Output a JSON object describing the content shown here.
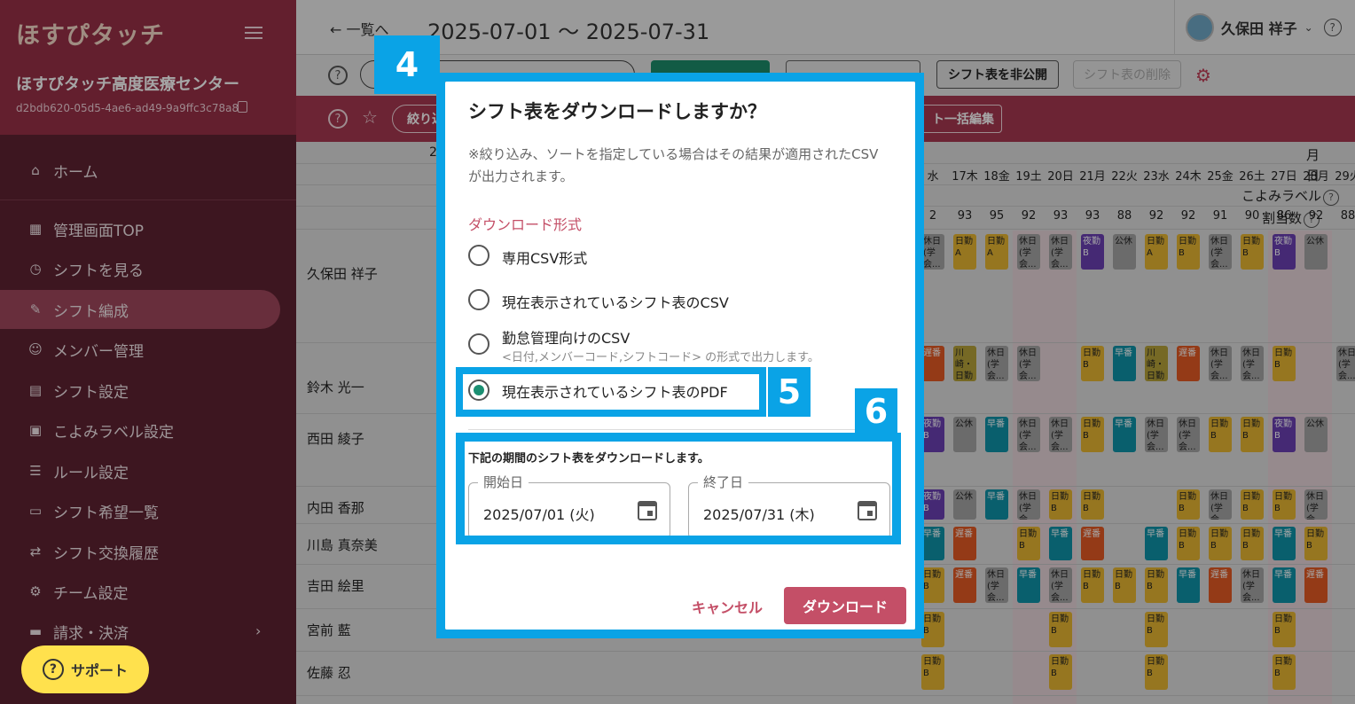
{
  "sidebar": {
    "logo": "ほすぴタッチ",
    "org_name": "ほすぴタッチ高度医療センター",
    "org_id": "d2bdb620-05d5-4ae6-ad49-9a9ffc3c78a8",
    "items": [
      {
        "label": "ホーム",
        "icon": "⌂"
      },
      {
        "label": "管理画面TOP",
        "icon": "▦"
      },
      {
        "label": "シフトを見る",
        "icon": "◷"
      },
      {
        "label": "シフト編成",
        "icon": "✎"
      },
      {
        "label": "メンバー管理",
        "icon": "☺"
      },
      {
        "label": "シフト設定",
        "icon": "▤"
      },
      {
        "label": "こよみラベル設定",
        "icon": "▣"
      },
      {
        "label": "ルール設定",
        "icon": "☰"
      },
      {
        "label": "シフト希望一覧",
        "icon": "▭"
      },
      {
        "label": "シフト交換履歴",
        "icon": "⇄"
      },
      {
        "label": "チーム設定",
        "icon": "⚙"
      },
      {
        "label": "請求・決済",
        "icon": "▬"
      }
    ],
    "chevron": "›",
    "support_label": "サポート",
    "support_icon": "?"
  },
  "topbar": {
    "back_label": "← 一覧へ",
    "date_range": "2025-07-01 〜 2025-07-31",
    "user_name": "久保田 祥子",
    "chevron": "⌄",
    "help": "?"
  },
  "toolbar": {
    "help": "?",
    "unpublish_label": "シフト表を非公開",
    "delete_label": "シフト表の削除",
    "gear": "⚙"
  },
  "filterbar": {
    "help": "?",
    "star": "☆",
    "filter_label": "絞り込",
    "bulk_label": "ト一括編集"
  },
  "grid": {
    "row_labels": {
      "month": "月",
      "day": "日",
      "koyomi": "こよみラベル",
      "count": "割当数",
      "help": "?"
    },
    "month_visible": "2",
    "members": [
      "久保田 祥子",
      "鈴木 光一",
      "西田 綾子",
      "内田 香那",
      "川島 真奈美",
      "吉田 絵里",
      "宮前 藍",
      "佐藤 忍"
    ],
    "days": [
      "水",
      "17木",
      "18金",
      "19土",
      "20日",
      "21月",
      "22火",
      "23水",
      "24木",
      "25金",
      "26土",
      "27日",
      "28月",
      "29火"
    ],
    "counts": [
      "2",
      "93",
      "95",
      "92",
      "93",
      "93",
      "88",
      "92",
      "92",
      "91",
      "90",
      "86",
      "92",
      "88"
    ],
    "rows": [
      [
        [
          "c-g",
          "休日(学会..."
        ],
        [
          "c-y",
          "日勤A"
        ],
        [
          "c-y",
          "日勤A"
        ],
        [
          "c-g",
          "休日(学会..."
        ],
        [
          "c-g",
          "休日(学会..."
        ],
        [
          "c-p",
          "夜勤B"
        ],
        [
          "c-g",
          "公休"
        ],
        [
          "c-y",
          "日勤A"
        ],
        [
          "c-y",
          "日勤B"
        ],
        [
          "c-g",
          "休日(学会..."
        ],
        [
          "c-y",
          "日勤B"
        ],
        [
          "c-p",
          "夜勤B"
        ],
        [
          "c-g",
          "公休"
        ]
      ],
      [
        [
          "c-o",
          "遅番"
        ],
        [
          "c-l",
          "川崎・日勤"
        ],
        [
          "c-g",
          "休日(学会..."
        ],
        [
          "c-g",
          "休日(学会..."
        ],
        [
          "",
          ""
        ],
        [
          "c-y",
          "日勤B"
        ],
        [
          "c-c",
          "早番"
        ],
        [
          "c-l",
          "川崎・日勤"
        ],
        [
          "c-o",
          "遅番"
        ],
        [
          "c-g",
          "休日(学会..."
        ],
        [
          "c-g",
          "休日(学会..."
        ],
        [
          "c-y",
          "日勤B"
        ],
        [
          "",
          ""
        ],
        [
          "c-g",
          "休日(学会..."
        ]
      ],
      [
        [
          "c-p",
          "夜勤B"
        ],
        [
          "c-g",
          "公休"
        ],
        [
          "c-c",
          "早番"
        ],
        [
          "c-g",
          "休日(学会..."
        ],
        [
          "c-g",
          "休日(学会..."
        ],
        [
          "c-y",
          "日勤B"
        ],
        [
          "c-c",
          "早番"
        ],
        [
          "c-g",
          "休日(学会..."
        ],
        [
          "c-g",
          "休日(学会..."
        ],
        [
          "c-y",
          "日勤B"
        ],
        [
          "c-y",
          "日勤B"
        ],
        [
          "c-p",
          "夜勤B"
        ],
        [
          "c-g",
          "公休"
        ]
      ],
      [
        [
          "c-p",
          "夜勤B"
        ],
        [
          "c-g",
          "公休"
        ],
        [
          "c-c",
          "早番"
        ],
        [
          "c-g",
          "休日(学会..."
        ],
        [
          "c-y",
          "日勤B"
        ],
        [
          "c-y",
          "日勤B"
        ],
        [
          "",
          ""
        ],
        [
          "",
          ""
        ],
        [
          "c-y",
          "日勤B"
        ],
        [
          "c-g",
          "休日(学会..."
        ],
        [
          "c-y",
          "日勤B"
        ],
        [
          "c-y",
          "日勤B"
        ],
        [
          "c-g",
          "休日(学会..."
        ]
      ],
      [
        [
          "c-c",
          "早番"
        ],
        [
          "c-o",
          "遅番"
        ],
        [
          "",
          ""
        ],
        [
          "c-y",
          "日勤B"
        ],
        [
          "c-c",
          "早番"
        ],
        [
          "c-o",
          "遅番"
        ],
        [
          "",
          ""
        ],
        [
          "c-c",
          "早番"
        ],
        [
          "c-y",
          "日勤B"
        ],
        [
          "c-y",
          "日勤B"
        ],
        [
          "c-y",
          "日勤B"
        ],
        [
          "c-c",
          "早番"
        ],
        [
          "c-y",
          "日勤B"
        ]
      ],
      [
        [
          "c-y",
          "日勤B"
        ],
        [
          "c-o",
          "遅番"
        ],
        [
          "c-g",
          "休日(学会..."
        ],
        [
          "c-c",
          "早番"
        ],
        [
          "c-g",
          "休日(学会..."
        ],
        [
          "c-y",
          "日勤B"
        ],
        [
          "c-y",
          "日勤B"
        ],
        [
          "c-y",
          "日勤B"
        ],
        [
          "c-c",
          "早番"
        ],
        [
          "c-o",
          "遅番"
        ],
        [
          "c-g",
          "休日(学会..."
        ],
        [
          "c-c",
          "早番"
        ],
        [
          "c-o",
          "遅番"
        ]
      ],
      [
        [
          "c-y",
          "日勤B"
        ],
        [
          "",
          ""
        ],
        [
          "",
          ""
        ],
        [
          "",
          ""
        ],
        [
          "c-y",
          "日勤B"
        ],
        [
          "",
          ""
        ],
        [
          "",
          ""
        ],
        [
          "c-y",
          "日勤B"
        ],
        [
          "",
          ""
        ],
        [
          "",
          ""
        ],
        [
          "",
          ""
        ],
        [
          "c-y",
          "日勤B"
        ],
        [
          "",
          ""
        ]
      ],
      [
        [
          "c-y",
          "日勤B"
        ],
        [
          "",
          ""
        ],
        [
          "",
          ""
        ],
        [
          "",
          ""
        ],
        [
          "c-y",
          "日勤B"
        ],
        [
          "",
          ""
        ],
        [
          "",
          ""
        ],
        [
          "c-y",
          "日勤B"
        ],
        [
          "",
          ""
        ],
        [
          "",
          ""
        ],
        [
          "",
          ""
        ],
        [
          "c-y",
          "日勤B"
        ],
        [
          "",
          ""
        ]
      ]
    ],
    "left_cells": {
      "labels": [
        "日勤B",
        "日勤B",
        "日勤B",
        "日勤B",
        "日勤B",
        "日勤B"
      ]
    }
  },
  "modal": {
    "title": "シフト表をダウンロードしますか？",
    "note": "※絞り込み、ソートを指定している場合はその結果が適用されたCSVが出力されます。",
    "format_label": "ダウンロード形式",
    "options": [
      {
        "label": "専用CSV形式",
        "checked": false
      },
      {
        "label": "現在表示されているシフト表のCSV",
        "checked": false
      },
      {
        "label": "勤怠管理向けのCSV",
        "checked": false
      },
      {
        "label": "現在表示されているシフト表のPDF",
        "checked": true
      }
    ],
    "option3_sub": "<日付,メンバーコード,シフトコード> の形式で出力します。",
    "period_title": "下記の期間のシフト表をダウンロードします。",
    "start_label": "開始日",
    "start_value": "2025/07/01 (火)",
    "end_label": "終了日",
    "end_value": "2025/07/31 (木)",
    "cancel_label": "キャンセル",
    "download_label": "ダウンロード"
  },
  "annotations": {
    "tag4": "4",
    "tag5": "5",
    "tag6": "6"
  },
  "colors": {
    "highlight": "#0aa3e6",
    "accent": "#c44f67",
    "sidebar": "#5e2232",
    "radio_checked": "#1a8f72"
  }
}
